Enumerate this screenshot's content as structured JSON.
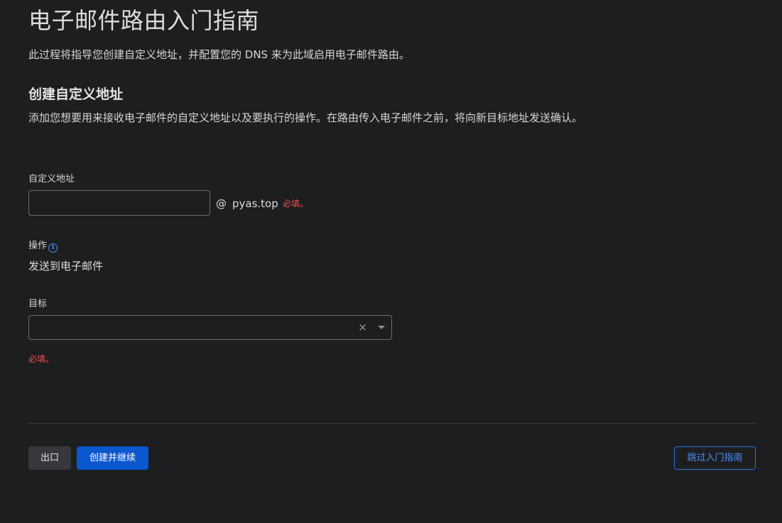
{
  "header": {
    "title": "电子邮件路由入门指南",
    "intro": "此过程将指导您创建自定义地址，并配置您的 DNS 来为此域启用电子邮件路由。"
  },
  "section": {
    "heading": "创建自定义地址",
    "description": "添加您想要用来接收电子邮件的自定义地址以及要执行的操作。在路由传入电子邮件之前，将向新目标地址发送确认。"
  },
  "custom_address": {
    "label": "自定义地址",
    "value": "",
    "at": "@",
    "domain": "pyas.top",
    "required": "必填。"
  },
  "action": {
    "label": "操作",
    "info_icon": "info-circle-icon",
    "value": "发送到电子邮件"
  },
  "destination": {
    "label": "目标",
    "value": "",
    "clear_glyph": "×",
    "required": "必填。"
  },
  "buttons": {
    "exit": "出口",
    "create_continue": "创建并继续",
    "skip": "跳过入门指南"
  },
  "colors": {
    "background": "#1d1e20",
    "primary": "#0b57d0",
    "link": "#4d8ef5",
    "error": "#f04d4d"
  }
}
